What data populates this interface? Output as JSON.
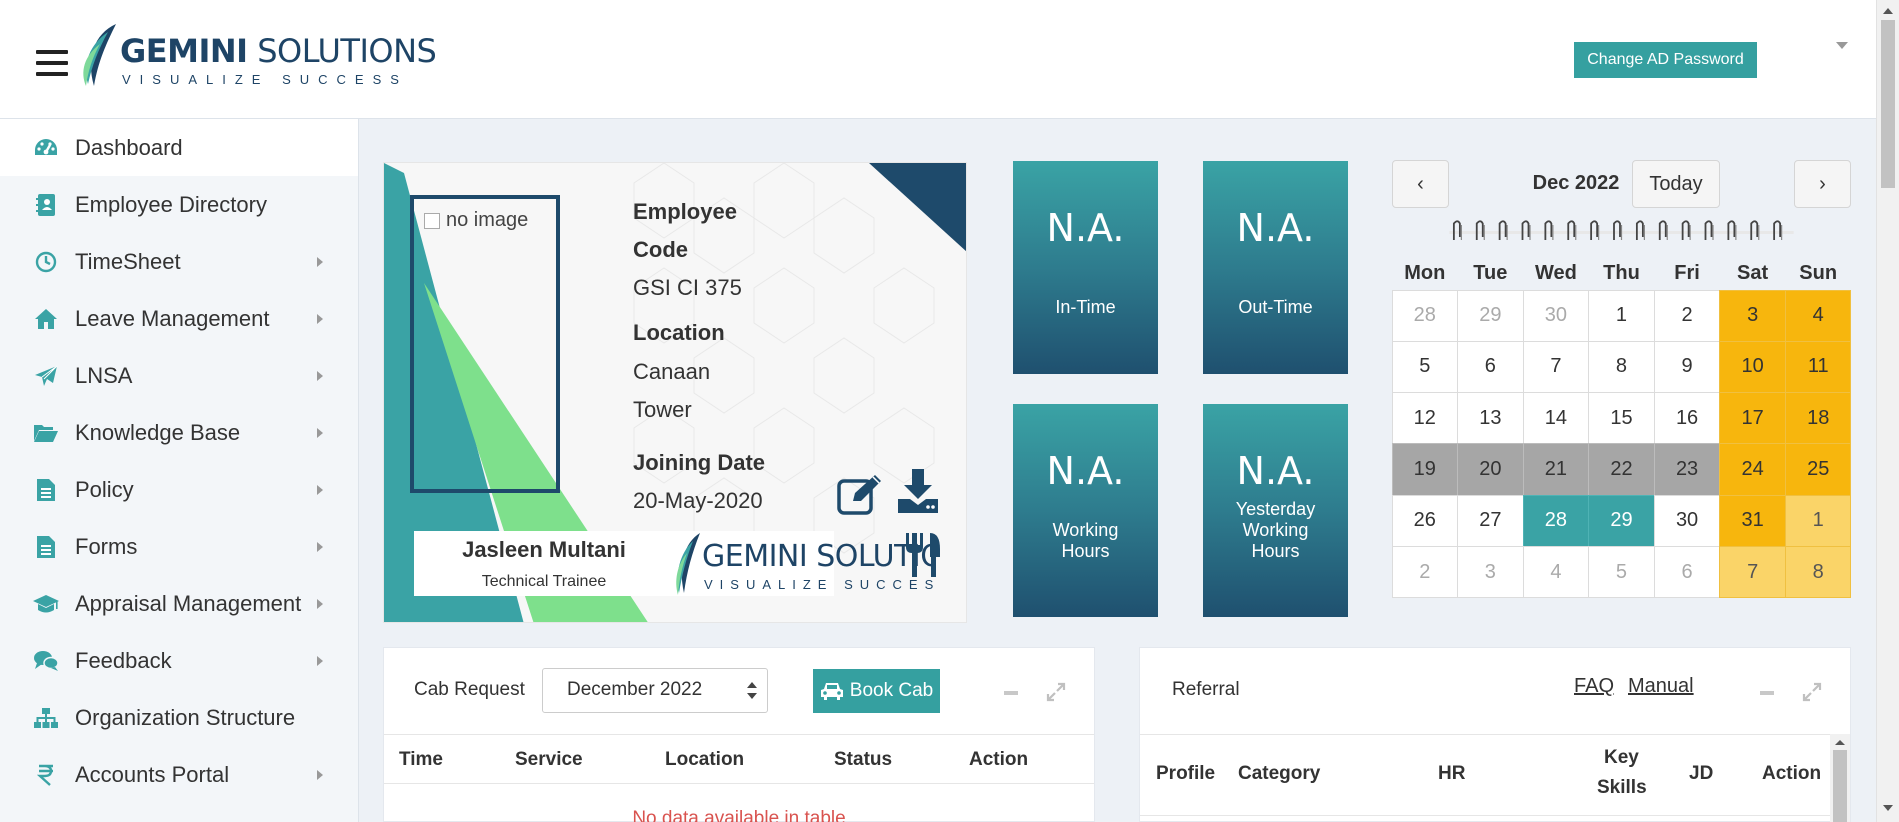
{
  "header": {
    "logo_main_bold": "GEMINI",
    "logo_main_rest": " SOLUTIONS",
    "logo_sub": "VISUALIZE SUCCESS",
    "change_password_label": "Change AD Password"
  },
  "sidebar": {
    "items": [
      {
        "label": "Dashboard",
        "icon": "dashboard-icon",
        "submenu": false,
        "active": true
      },
      {
        "label": "Employee Directory",
        "icon": "contact-book-icon",
        "submenu": false
      },
      {
        "label": "TimeSheet",
        "icon": "clock-icon",
        "submenu": true
      },
      {
        "label": "Leave Management",
        "icon": "home-icon",
        "submenu": true
      },
      {
        "label": "LNSA",
        "icon": "paper-plane-icon",
        "submenu": true
      },
      {
        "label": "Knowledge Base",
        "icon": "folder-open-icon",
        "submenu": true
      },
      {
        "label": "Policy",
        "icon": "document-icon",
        "submenu": true
      },
      {
        "label": "Forms",
        "icon": "document-icon",
        "submenu": true
      },
      {
        "label": "Appraisal Management",
        "icon": "graduation-cap-icon",
        "submenu": true
      },
      {
        "label": "Feedback",
        "icon": "chat-icon",
        "submenu": true
      },
      {
        "label": "Organization Structure",
        "icon": "sitemap-icon",
        "submenu": false
      },
      {
        "label": "Accounts Portal",
        "icon": "rupee-icon",
        "submenu": true
      }
    ]
  },
  "idcard": {
    "photo_alt": "no image",
    "code_label_1": "Employee",
    "code_label_2": "Code",
    "code_value": "GSI CI 375",
    "location_label": "Location",
    "location_value_1": "Canaan",
    "location_value_2": "Tower",
    "joining_label": "Joining Date",
    "joining_value": "20-May-2020",
    "name": "Jasleen Multani",
    "role": "Technical Trainee",
    "logo_main": "GEMINI SOLUTIONS",
    "logo_sub": "VISUALIZE SUCCESS"
  },
  "tiles": {
    "in_time": {
      "value": "N.A.",
      "label": "In-Time"
    },
    "out_time": {
      "value": "N.A.",
      "label": "Out-Time"
    },
    "working_hours": {
      "value": "N.A.",
      "label_1": "Working",
      "label_2": "Hours"
    },
    "yesterday": {
      "value": "N.A.",
      "label_1": "Yesterday",
      "label_2": "Working",
      "label_3": "Hours"
    }
  },
  "calendar": {
    "title": "Dec 2022",
    "prev": "‹",
    "next": "›",
    "today_label": "Today",
    "weekdays": [
      "Mon",
      "Tue",
      "Wed",
      "Thu",
      "Fri",
      "Sat",
      "Sun"
    ],
    "days": [
      {
        "d": "28",
        "t": "muted"
      },
      {
        "d": "29",
        "t": "muted"
      },
      {
        "d": "30",
        "t": "muted"
      },
      {
        "d": "1",
        "t": ""
      },
      {
        "d": "2",
        "t": ""
      },
      {
        "d": "3",
        "t": "weekend"
      },
      {
        "d": "4",
        "t": "weekend"
      },
      {
        "d": "5",
        "t": ""
      },
      {
        "d": "6",
        "t": ""
      },
      {
        "d": "7",
        "t": ""
      },
      {
        "d": "8",
        "t": ""
      },
      {
        "d": "9",
        "t": ""
      },
      {
        "d": "10",
        "t": "weekend"
      },
      {
        "d": "11",
        "t": "weekend"
      },
      {
        "d": "12",
        "t": ""
      },
      {
        "d": "13",
        "t": ""
      },
      {
        "d": "14",
        "t": ""
      },
      {
        "d": "15",
        "t": ""
      },
      {
        "d": "16",
        "t": ""
      },
      {
        "d": "17",
        "t": "weekend"
      },
      {
        "d": "18",
        "t": "weekend"
      },
      {
        "d": "19",
        "t": "grey"
      },
      {
        "d": "20",
        "t": "grey"
      },
      {
        "d": "21",
        "t": "grey"
      },
      {
        "d": "22",
        "t": "grey"
      },
      {
        "d": "23",
        "t": "grey"
      },
      {
        "d": "24",
        "t": "weekend"
      },
      {
        "d": "25",
        "t": "weekend"
      },
      {
        "d": "26",
        "t": ""
      },
      {
        "d": "27",
        "t": ""
      },
      {
        "d": "28",
        "t": "teal"
      },
      {
        "d": "29",
        "t": "teal"
      },
      {
        "d": "30",
        "t": ""
      },
      {
        "d": "31",
        "t": "weekend"
      },
      {
        "d": "1",
        "t": "weekend muted"
      },
      {
        "d": "2",
        "t": "muted"
      },
      {
        "d": "3",
        "t": "muted"
      },
      {
        "d": "4",
        "t": "muted"
      },
      {
        "d": "5",
        "t": "muted"
      },
      {
        "d": "6",
        "t": "muted"
      },
      {
        "d": "7",
        "t": "weekend muted"
      },
      {
        "d": "8",
        "t": "weekend muted"
      }
    ]
  },
  "cab": {
    "title": "Cab Request",
    "month_value": "December 2022",
    "book_label": "Book Cab",
    "columns": [
      "Time",
      "Service",
      "Location",
      "Status",
      "Action"
    ],
    "empty_text": "No data available in table"
  },
  "referral": {
    "title": "Referral",
    "faq_label": "FAQ",
    "manual_label": "Manual",
    "col_profile": "Profile",
    "col_category": "Category",
    "col_hr": "HR",
    "col_key": "Key",
    "col_skills": "Skills",
    "col_jd": "JD",
    "col_action": "Action"
  },
  "colors": {
    "accent": "#35a0a0",
    "navy": "#1e4a6b",
    "weekend": "#f7b60d"
  }
}
